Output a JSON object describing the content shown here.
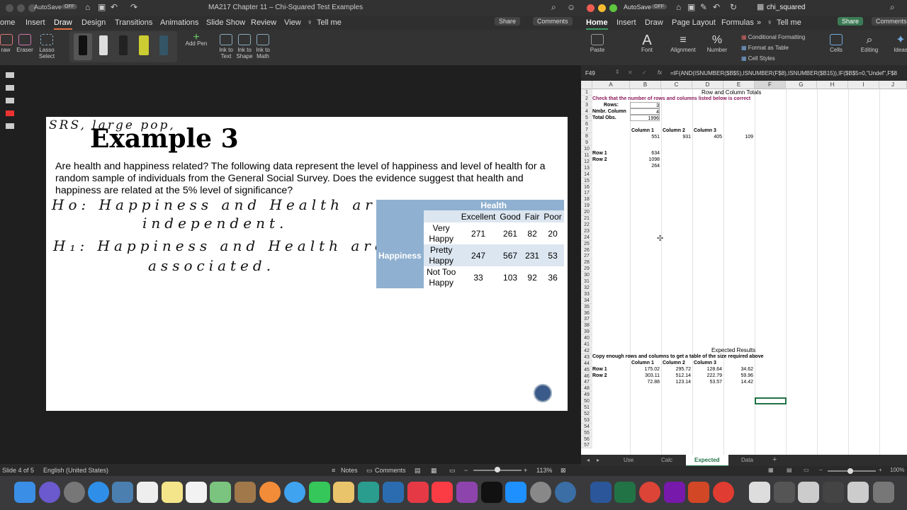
{
  "ppt": {
    "title": "MA217 Chapter 11 – Chi-Squared Test Examples",
    "autosave": "AutoSave",
    "autosave_state": "OFF",
    "tabs": [
      "ome",
      "Insert",
      "Draw",
      "Design",
      "Transitions",
      "Animations",
      "Slide Show",
      "Review",
      "View",
      "Tell me"
    ],
    "share": "Share",
    "comments": "Comments",
    "tools": [
      "raw",
      "Eraser",
      "Lasso\nSelect",
      "Add Pen",
      "Ink to\nText",
      "Ink to\nShape",
      "Ink to\nMath"
    ],
    "slide": {
      "title": "Example 3",
      "annotation": "SRS, large pop,",
      "question": "Are health and happiness related?  The following data represent the level of happiness and level of health for a random sample of individuals from the General Social Survey. Does the evidence suggest that health and happiness are related at the 5% level of significance?",
      "h0a": "Ho: Happiness and Health are",
      "h0b": "independent.",
      "h1a": "H₁: Happiness and Health are",
      "h1b": "associated.",
      "table": {
        "col_group": "Health",
        "row_group": "Happiness",
        "columns": [
          "Excellent",
          "Good",
          "Fair",
          "Poor"
        ],
        "rows": [
          {
            "label": "Very\nHappy",
            "values": [
              "271",
              "261",
              "82",
              "20"
            ]
          },
          {
            "label": "Pretty\nHappy",
            "values": [
              "247",
              "567",
              "231",
              "53"
            ]
          },
          {
            "label": "Not Too\nHappy",
            "values": [
              "33",
              "103",
              "92",
              "36"
            ]
          }
        ]
      }
    },
    "status": {
      "slide": "Slide 4 of 5",
      "lang": "English (United States)",
      "notes": "Notes",
      "comments": "Comments",
      "zoom": "113%"
    }
  },
  "xl": {
    "title": "chi_squared",
    "autosave": "AutoSave",
    "autosave_state": "OFF",
    "tabs": [
      "Home",
      "Insert",
      "Draw",
      "Page Layout",
      "Formulas",
      "Tell me"
    ],
    "share": "Share",
    "comments": "Comments",
    "ribbon": {
      "paste": "Paste",
      "font": "Font",
      "alignment": "Alignment",
      "number": "Number",
      "cond": "Conditional Formatting",
      "fmt_table": "Format as Table",
      "cell_styles": "Cell Styles",
      "cells": "Cells",
      "editing": "Editing",
      "ideas": "Ideas"
    },
    "namebox": "F49",
    "formula": "=IF(AND(ISNUMBER($B$5),ISNUMBER(F$8),ISNUMBER($B15)),IF($B$5=0,\"Undef\",F$8",
    "columns": [
      "A",
      "B",
      "C",
      "D",
      "E",
      "F",
      "G",
      "H",
      "I",
      "J"
    ],
    "cells": {
      "r1": "Row and Column Totals",
      "r2": "Check that the number of rows and columns listed below is correct",
      "r3a": "Rows:",
      "r3b": "3",
      "r4a": "Nmbr. Column",
      "r4b": "4",
      "r5a": "Total Obs.",
      "r5b": "1996",
      "r7": [
        "Column 1",
        "Column 2",
        "Column 3"
      ],
      "r8": [
        "551",
        "931",
        "405",
        "109"
      ],
      "r10a": "Row 1",
      "r10b": "634",
      "r11a": "Row 2",
      "r11b": "1098",
      "r12b": "264",
      "r41": "Expected Results",
      "r42": "Copy enough rows and columns to get a table of the size required above",
      "r43": [
        "Column 1",
        "Column 2",
        "Column 3"
      ],
      "r44a": "Row 1",
      "r44": [
        "175.02",
        "295.72",
        "128.64",
        "34.62"
      ],
      "r45a": "Row 2",
      "r45": [
        "303.11",
        "512.14",
        "222.79",
        "59.96"
      ],
      "r46": [
        "72.88",
        "123.14",
        "53.57",
        "14.42"
      ]
    },
    "sheets": [
      "Use",
      "Calc",
      "Expected",
      "Data"
    ],
    "zoom": "100%"
  }
}
